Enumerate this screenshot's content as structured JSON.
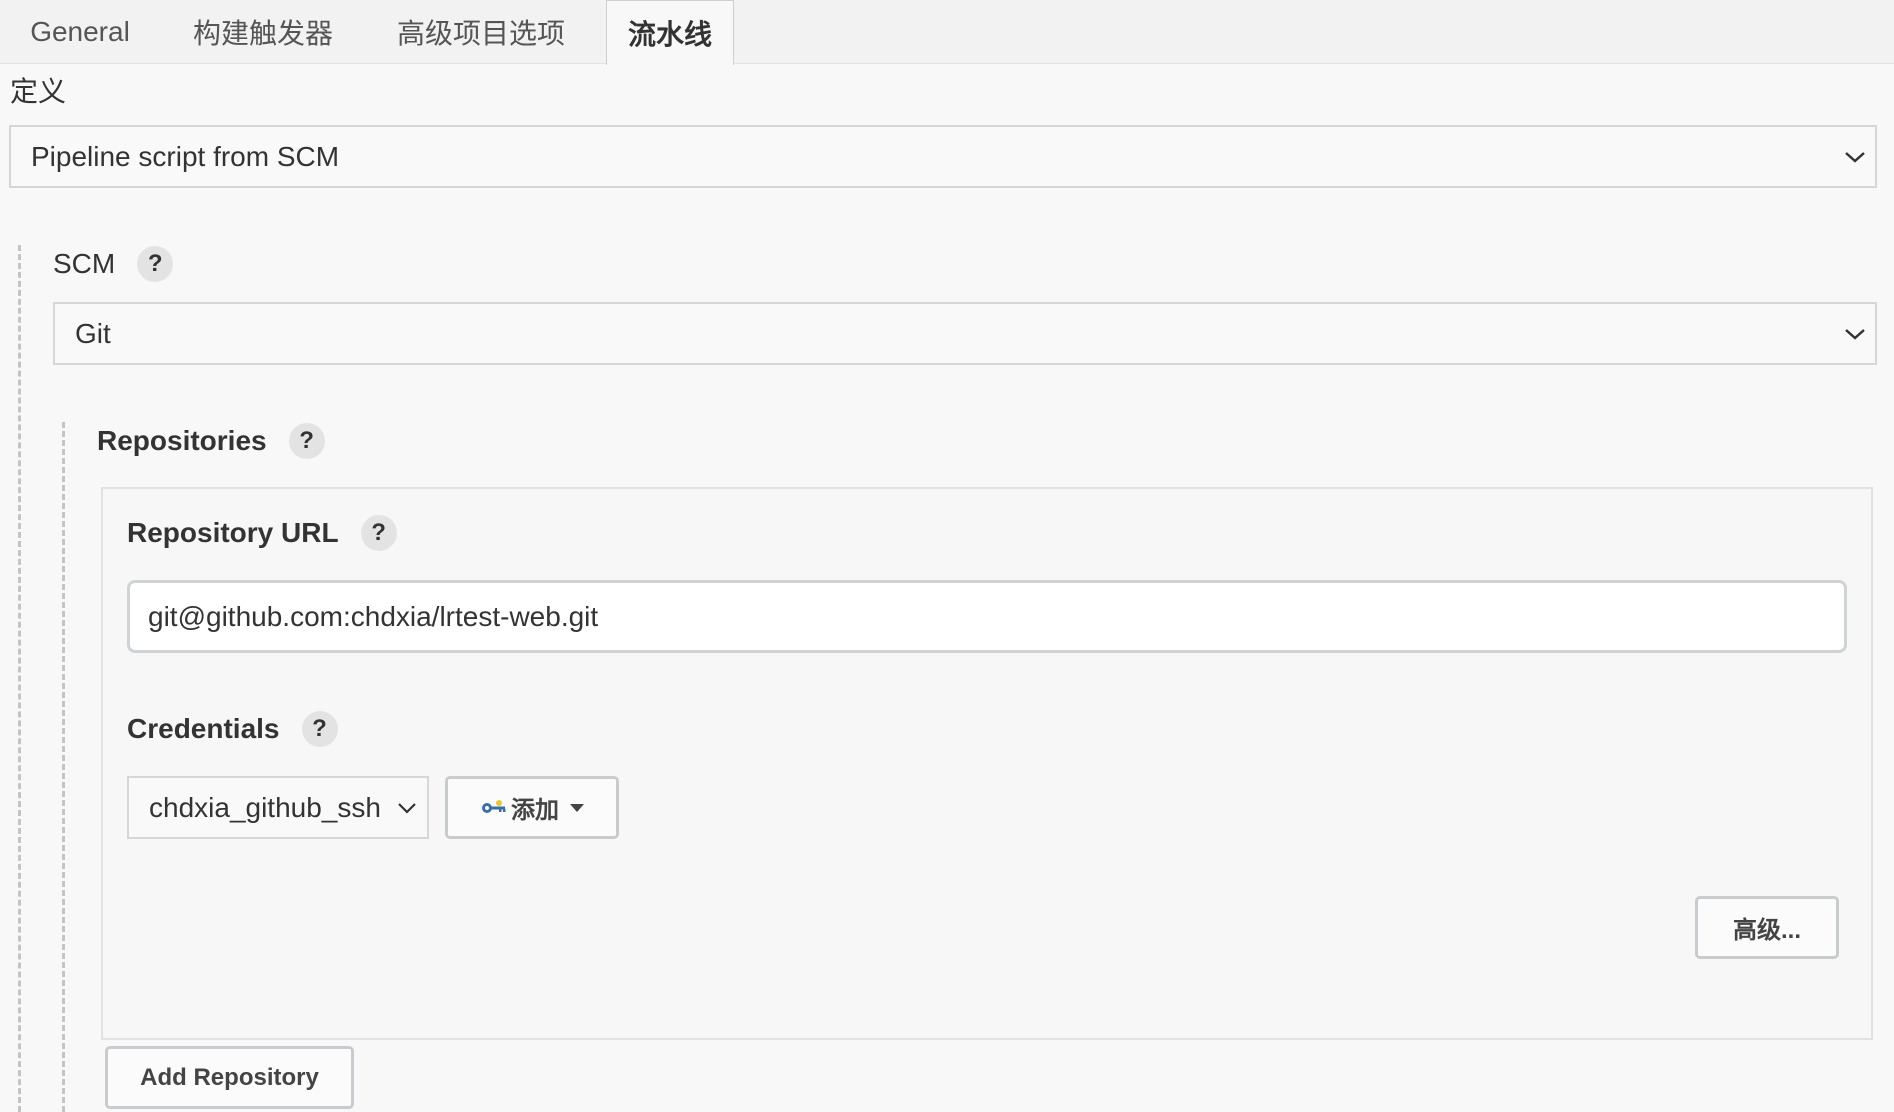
{
  "tabs": [
    {
      "label": "General"
    },
    {
      "label": "构建触发器"
    },
    {
      "label": "高级项目选项"
    },
    {
      "label": "流水线"
    }
  ],
  "definition": {
    "label": "定义",
    "selected": "Pipeline script from SCM"
  },
  "scm": {
    "label": "SCM",
    "help": "?",
    "selected": "Git"
  },
  "repositories": {
    "label": "Repositories",
    "help": "?",
    "url": {
      "label": "Repository URL",
      "help": "?",
      "value": "git@github.com:chdxia/lrtest-web.git"
    },
    "credentials": {
      "label": "Credentials",
      "help": "?",
      "selected": "chdxia_github_ssh",
      "add_label": "添加"
    },
    "advanced_label": "高级...",
    "add_repository_label": "Add Repository"
  },
  "icons": {
    "key": "key-icon",
    "caret": "caret-down-icon",
    "chevron": "chevron-down-icon"
  }
}
